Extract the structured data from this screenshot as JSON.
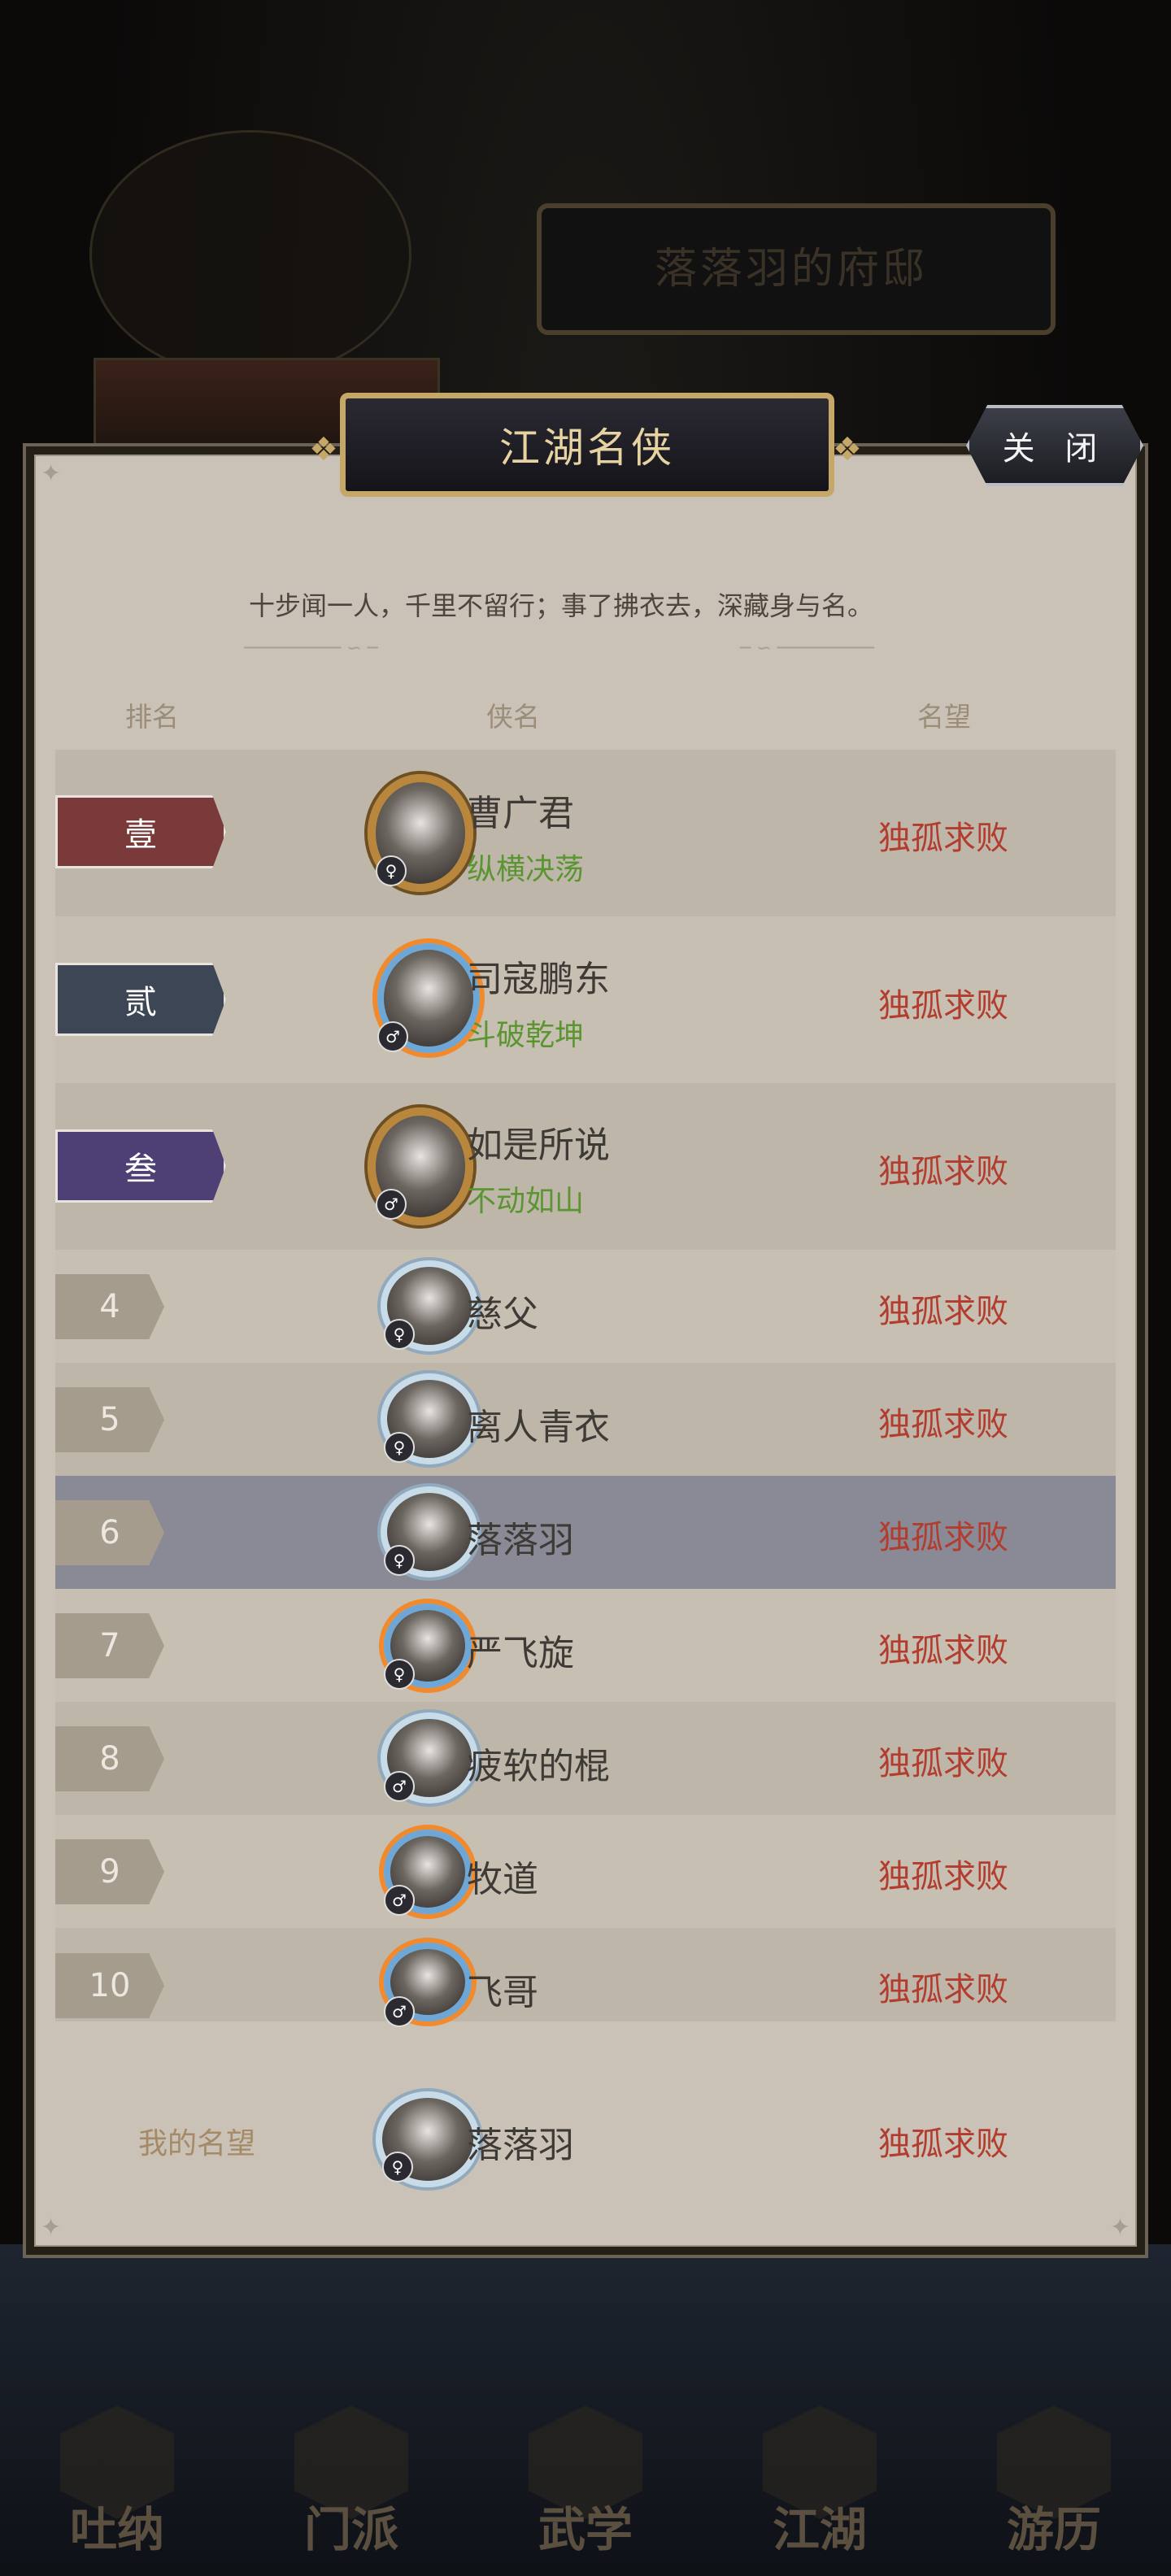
{
  "background": {
    "residence_title": "落落羽的府邸",
    "nav": [
      "吐纳",
      "门派",
      "武学",
      "江湖",
      "游历"
    ]
  },
  "panel": {
    "title": "江湖名侠",
    "close_label": "关 闭",
    "motto": "十步闻一人，千里不留行；事了拂衣去，深藏身与名。",
    "headers": {
      "rank": "排名",
      "name": "侠名",
      "fame": "名望"
    }
  },
  "rows": [
    {
      "rank": "壹",
      "name": "曹广君",
      "title": "纵横决荡",
      "fame": "独孤求败",
      "gender": "female",
      "frame": "gold"
    },
    {
      "rank": "贰",
      "name": "司寇鹏东",
      "title": "斗破乾坤",
      "fame": "独孤求败",
      "gender": "male",
      "frame": "fire"
    },
    {
      "rank": "叁",
      "name": "如是所说",
      "title": "不动如山",
      "fame": "独孤求败",
      "gender": "male",
      "frame": "gold"
    },
    {
      "rank": "4",
      "name": "慈父",
      "fame": "独孤求败",
      "gender": "female",
      "frame": "ice"
    },
    {
      "rank": "5",
      "name": "离人青衣",
      "fame": "独孤求败",
      "gender": "female",
      "frame": "ice"
    },
    {
      "rank": "6",
      "name": "落落羽",
      "fame": "独孤求败",
      "gender": "female",
      "frame": "ice",
      "self": true
    },
    {
      "rank": "7",
      "name": "严飞旋",
      "fame": "独孤求败",
      "gender": "female",
      "frame": "fire"
    },
    {
      "rank": "8",
      "name": "疲软的棍",
      "fame": "独孤求败",
      "gender": "male",
      "frame": "ice"
    },
    {
      "rank": "9",
      "name": "牧道",
      "fame": "独孤求败",
      "gender": "male",
      "frame": "fire"
    },
    {
      "rank": "10",
      "name": "飞哥",
      "fame": "独孤求败",
      "gender": "male",
      "frame": "fire"
    }
  ],
  "my": {
    "label": "我的名望",
    "name": "落落羽",
    "fame": "独孤求败",
    "gender": "female",
    "frame": "ice"
  },
  "colors": {
    "fame_red": "#b23c2e",
    "title_green": "#5a9531",
    "rank1": "#7a3a3a",
    "rank2": "#3d4654",
    "rank3": "#4e3f74",
    "self_row": "#8a8a96"
  },
  "icons": {
    "male": "male-icon",
    "female": "female-icon"
  }
}
